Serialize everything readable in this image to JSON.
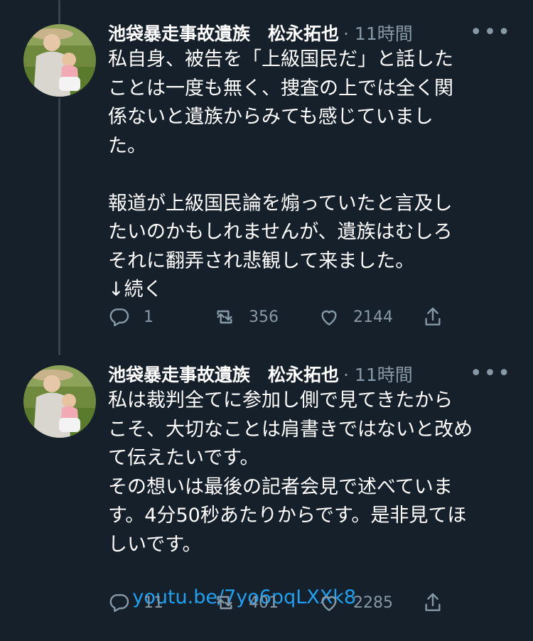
{
  "tweets": [
    {
      "author": "池袋暴走事故遺族　松永拓也",
      "meta": "· 11時間",
      "text": "私自身、被告を「上級国民だ」と話した\nことは一度も無く、捜査の上では全く関\n係ないと遺族からみても感じていまし\nた。\n\n報道が上級国民論を煽っていたと言及し\nたいのかもしれませんが、遺族はむしろ\nそれに翻弄され悲観して来ました。\n↓続く",
      "link": "",
      "replies": "1",
      "retweets": "356",
      "likes": "2144"
    },
    {
      "author": "池袋暴走事故遺族　松永拓也",
      "meta": "· 11時間",
      "text": "私は裁判全てに参加し側で見てきたから\nこそ、大切なことは肩書きではないと改め\nて伝えたいです。\nその想いは最後の記者会見で述べていま\nす。4分50秒あたりからです。是非見てほ\nしいです。",
      "link": "youtu.be/7yo6pqLXXk8",
      "replies": "11",
      "retweets": "401",
      "likes": "2285"
    }
  ],
  "icons": {
    "more": "more-dots-icon",
    "reply": "reply-icon",
    "retweet": "retweet-icon",
    "like": "heart-icon",
    "share": "share-icon"
  },
  "colors": {
    "background": "#15202b",
    "text": "#ffffff",
    "muted": "#8899a6",
    "link": "#1da1f2",
    "thread_line": "#38444d"
  }
}
